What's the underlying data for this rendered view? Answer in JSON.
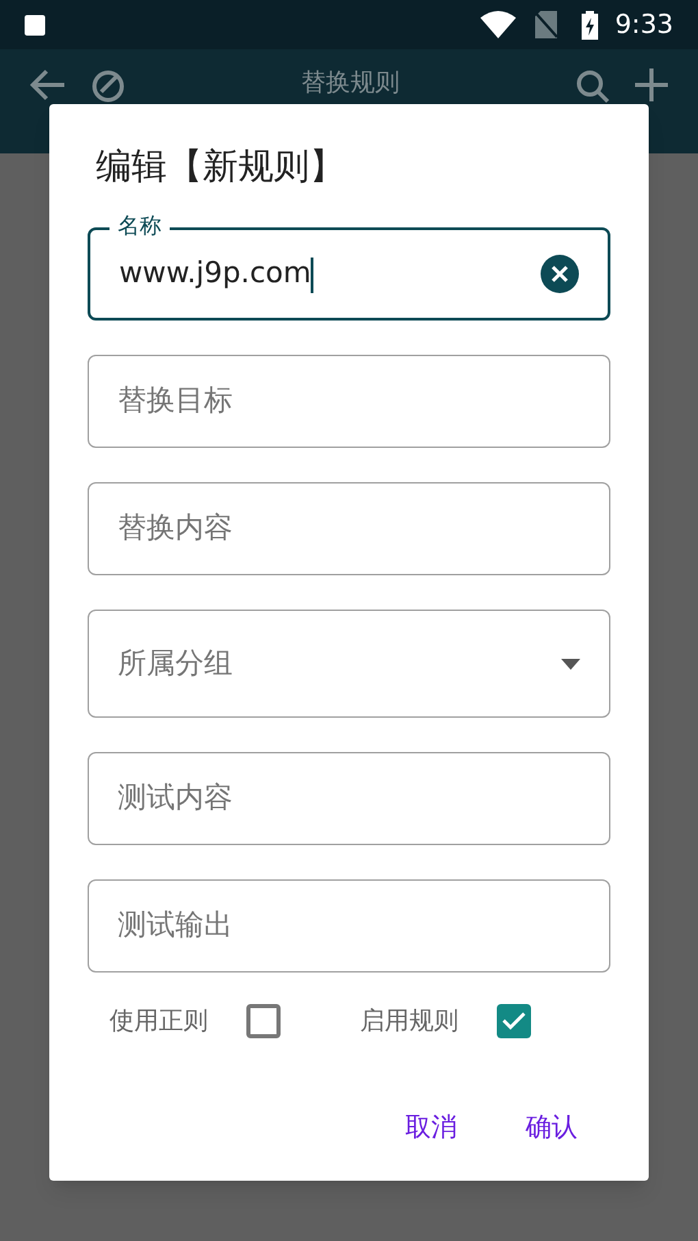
{
  "status_bar": {
    "time": "9:33"
  },
  "toolbar": {
    "title": "替换规则"
  },
  "dialog": {
    "title": "编辑【新规则】",
    "fields": [
      {
        "kind": "text",
        "label": "名称",
        "value": "www.j9p.com",
        "focused": true
      },
      {
        "kind": "text",
        "placeholder": "替换目标",
        "focused": false
      },
      {
        "kind": "text",
        "placeholder": "替换内容",
        "focused": false
      },
      {
        "kind": "dropdown",
        "placeholder": "所属分组",
        "focused": false
      },
      {
        "kind": "text",
        "placeholder": "测试内容",
        "focused": false
      },
      {
        "kind": "text",
        "placeholder": "测试输出",
        "focused": false
      }
    ],
    "options": [
      {
        "label": "使用正则",
        "checked": false
      },
      {
        "label": "启用规则",
        "checked": true
      }
    ],
    "buttons": [
      "取消",
      "确认"
    ]
  }
}
